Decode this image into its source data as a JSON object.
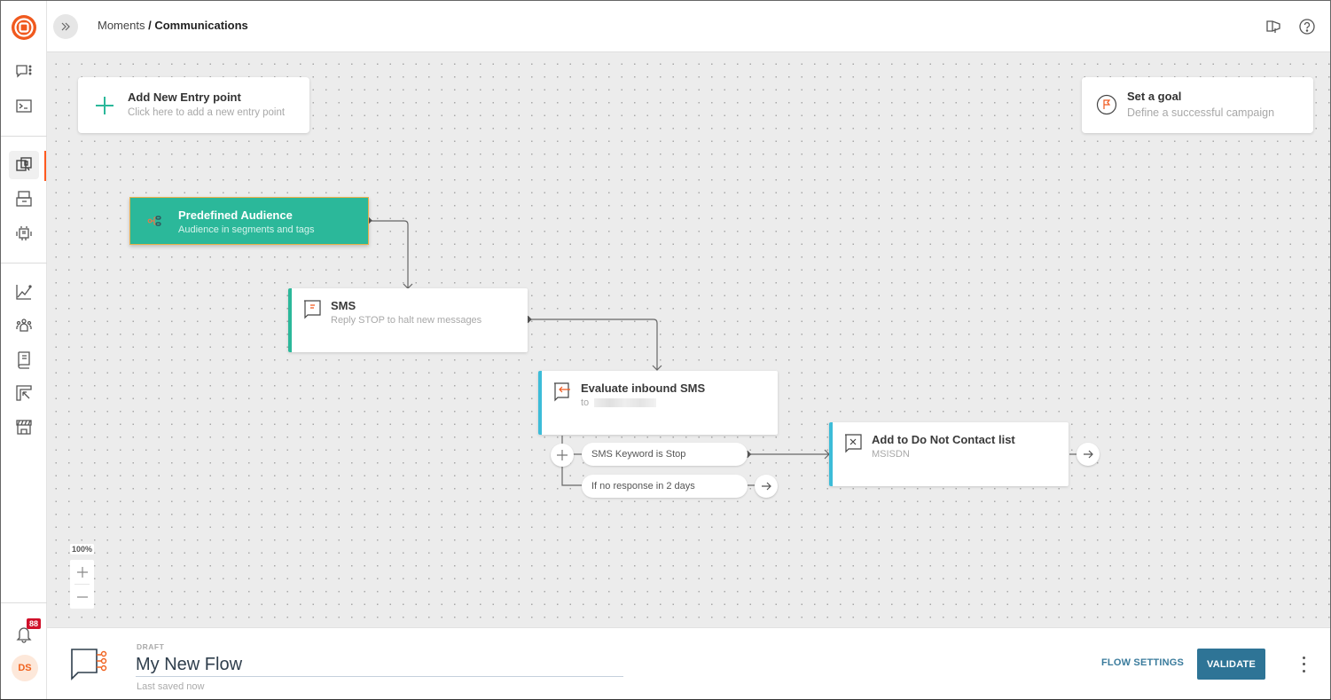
{
  "header": {
    "breadcrumb_parent": "Moments",
    "breadcrumb_separator": " / ",
    "breadcrumb_current": "Communications"
  },
  "sidebar": {
    "items": [
      {
        "name": "conversations",
        "icon": "chat-dots-icon"
      },
      {
        "name": "console",
        "icon": "terminal-icon"
      },
      {
        "name": "moments",
        "icon": "moments-icon",
        "active": true
      },
      {
        "name": "broadcast",
        "icon": "broadcast-icon"
      },
      {
        "name": "automation",
        "icon": "robot-icon"
      },
      {
        "name": "analytics",
        "icon": "chart-line-icon"
      },
      {
        "name": "people",
        "icon": "people-icon"
      },
      {
        "name": "docs",
        "icon": "book-icon"
      },
      {
        "name": "apps",
        "icon": "apps-cursor-icon"
      },
      {
        "name": "exchange",
        "icon": "store-icon"
      }
    ],
    "notification_count": "88",
    "avatar_initials": "DS",
    "accent_color": "#ff5a1f"
  },
  "canvas": {
    "entry_point": {
      "title": "Add New Entry point",
      "subtitle": "Click here to add a new entry point"
    },
    "goal": {
      "title": "Set a goal",
      "subtitle": "Define a successful campaign"
    },
    "nodes": [
      {
        "id": "audience",
        "title": "Predefined Audience",
        "subtitle": "Audience in segments and tags",
        "color": "#2bb89a"
      },
      {
        "id": "sms",
        "title": "SMS",
        "subtitle": "Reply STOP to halt new messages",
        "accent": "#2bb89a"
      },
      {
        "id": "evaluate",
        "title": "Evaluate inbound SMS",
        "subtitle": "to",
        "accent": "#3cbcd8"
      },
      {
        "id": "dnc",
        "title": "Add to Do Not Contact list",
        "subtitle": "MSISDN",
        "accent": "#3cbcd8"
      }
    ],
    "branches": [
      {
        "label": "SMS Keyword is Stop"
      },
      {
        "label": "If no response in 2 days"
      }
    ],
    "zoom_level": "100%"
  },
  "footer": {
    "status": "DRAFT",
    "flow_name": "My New Flow",
    "saved_status": "Last saved now",
    "flow_settings_label": "FLOW SETTINGS",
    "validate_label": "VALIDATE",
    "primary_color": "#2e7496"
  }
}
